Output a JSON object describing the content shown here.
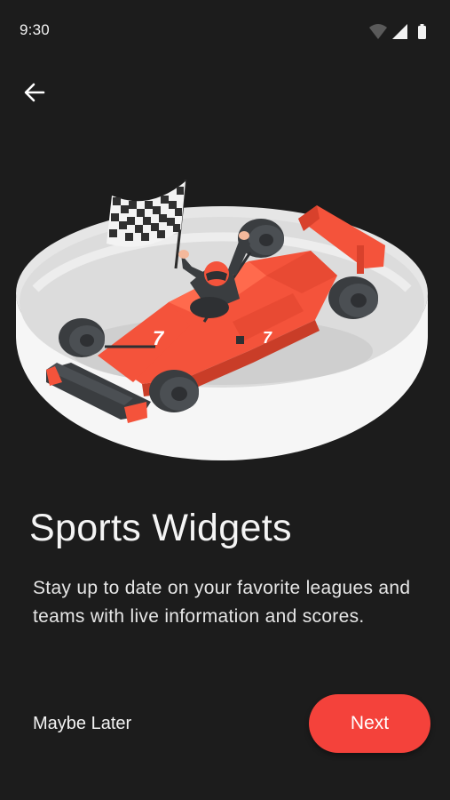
{
  "status_bar": {
    "time": "9:30",
    "icons": [
      "wifi-icon",
      "cellular-signal-icon",
      "battery-icon"
    ]
  },
  "header": {
    "back_icon": "arrow-left-icon"
  },
  "illustration": {
    "subject": "race-car-illustration",
    "car_number": "7"
  },
  "content": {
    "title": "Sports Widgets",
    "description": "Stay up to date on your favorite leagues and teams with live information and scores."
  },
  "actions": {
    "secondary_label": "Maybe Later",
    "primary_label": "Next"
  },
  "colors": {
    "background": "#1c1c1c",
    "accent": "#f4423b",
    "car_red": "#f4533b",
    "text": "#ffffff"
  }
}
